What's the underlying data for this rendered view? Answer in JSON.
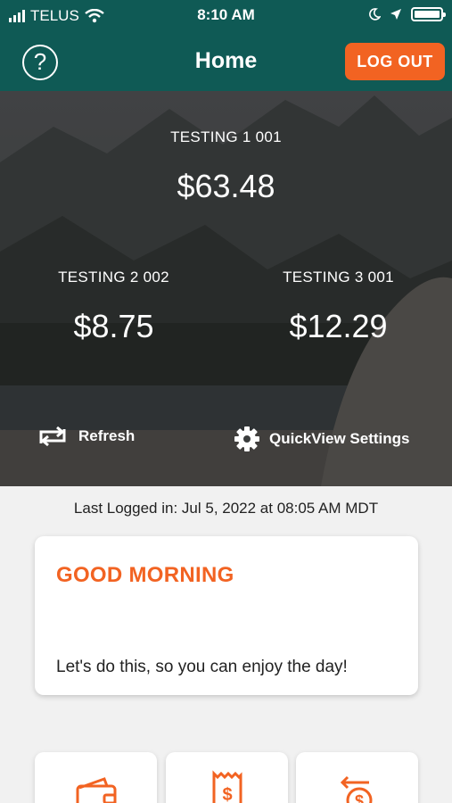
{
  "status_bar": {
    "carrier": "TELUS",
    "time": "8:10 AM"
  },
  "header": {
    "title": "Home",
    "help_symbol": "?",
    "logout_label": "LOG OUT"
  },
  "accounts": [
    {
      "name": "TESTING 1 001",
      "balance": "$63.48"
    },
    {
      "name": "TESTING 2 002",
      "balance": "$8.75"
    },
    {
      "name": "TESTING 3 001",
      "balance": "$12.29"
    }
  ],
  "actions": {
    "refresh_label": "Refresh",
    "quickview_label": "QuickView Settings"
  },
  "last_logged": "Last Logged in: Jul 5, 2022 at 08:05 AM  MDT",
  "greeting_card": {
    "title": "GOOD MORNING",
    "message": "Let's do this, so you can enjoy the day!"
  },
  "tiles": [
    {
      "icon": "wallet-icon"
    },
    {
      "icon": "receipt-dollar-icon"
    },
    {
      "icon": "transfer-dollar-icon"
    }
  ],
  "colors": {
    "header_teal": "#0f5a55",
    "accent_orange": "#f26322",
    "background": "#f1f1f1"
  }
}
